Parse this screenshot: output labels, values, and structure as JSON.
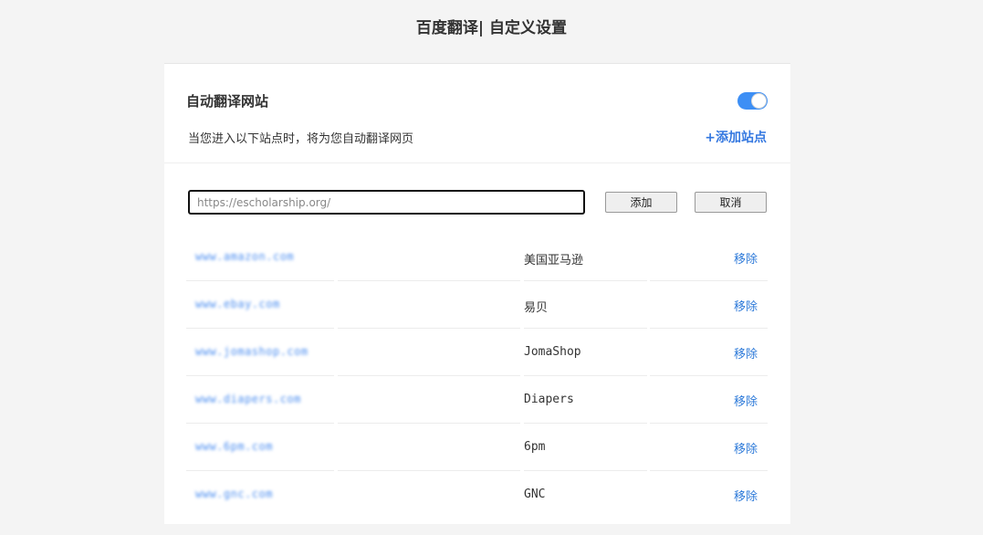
{
  "header": {
    "title": "百度翻译| 自定义设置"
  },
  "section": {
    "title": "自动翻译网站",
    "toggle_on": true,
    "description": "当您进入以下站点时，将为您自动翻译网页",
    "add_site_label": "+添加站点"
  },
  "add_form": {
    "input_value": "https://escholarship.org/",
    "add_label": "添加",
    "cancel_label": "取消"
  },
  "sites": [
    {
      "url": "www.amazon.com",
      "name": "美国亚马逊",
      "remove_label": "移除"
    },
    {
      "url": "www.ebay.com",
      "name": "易贝",
      "remove_label": "移除"
    },
    {
      "url": "www.jomashop.com",
      "name": "JomaShop",
      "remove_label": "移除"
    },
    {
      "url": "www.diapers.com",
      "name": "Diapers",
      "remove_label": "移除"
    },
    {
      "url": "www.6pm.com",
      "name": "6pm",
      "remove_label": "移除"
    },
    {
      "url": "www.gnc.com",
      "name": "GNC",
      "remove_label": "移除"
    }
  ],
  "colors": {
    "accent": "#3d8ff5",
    "link": "#2d7ad9"
  }
}
